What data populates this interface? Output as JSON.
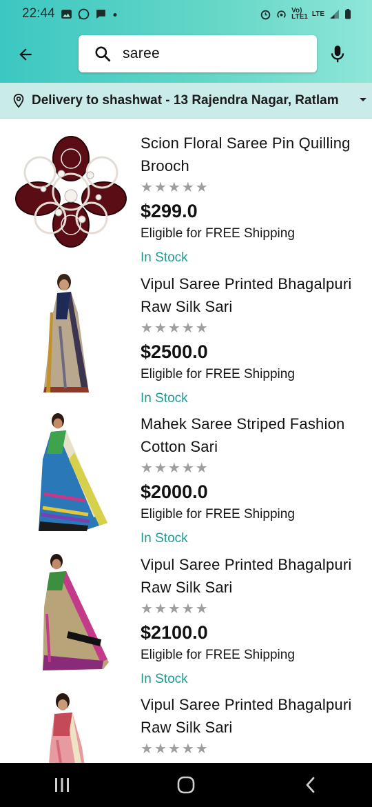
{
  "status_bar": {
    "time": "22:44",
    "network": "LTE"
  },
  "search": {
    "query": "saree"
  },
  "delivery": {
    "text": "Delivery to shashwat - 13 Rajendra Nagar, Ratlam"
  },
  "products": [
    {
      "title": "Scion Floral Saree Pin Quilling Brooch",
      "rating": 0,
      "price": "$299.0",
      "shipping": "Eligible for FREE Shipping",
      "stock": "In Stock",
      "image": "brooch"
    },
    {
      "title": "Vipul Saree Printed Bhagalpuri Raw Silk Sari",
      "rating": 0,
      "price": "$2500.0",
      "shipping": "Eligible for FREE Shipping",
      "stock": "In Stock",
      "image": "saree-model"
    },
    {
      "title": "Mahek Saree Striped Fashion Cotton Sari",
      "rating": 0,
      "price": "$2000.0",
      "shipping": "Eligible for FREE Shipping",
      "stock": "In Stock",
      "image": "saree-model"
    },
    {
      "title": "Vipul Saree Printed Bhagalpuri Raw Silk Sari",
      "rating": 0,
      "price": "$2100.0",
      "shipping": "Eligible for FREE Shipping",
      "stock": "In Stock",
      "image": "saree-model"
    },
    {
      "title": "Vipul Saree Printed Bhagalpuri Raw Silk Sari",
      "rating": 0,
      "image": "saree-model"
    }
  ],
  "colors": {
    "header": "#3cc7c2",
    "delivery_bar": "#c9ece9",
    "in_stock": "#1c9b93",
    "star_empty": "#9e9e9e"
  },
  "icons": {
    "back": "arrow-left-icon",
    "search": "search-icon",
    "mic": "mic-icon",
    "location": "location-pin-icon",
    "nav": [
      "recents-icon",
      "home-icon",
      "back-nav-icon"
    ]
  }
}
